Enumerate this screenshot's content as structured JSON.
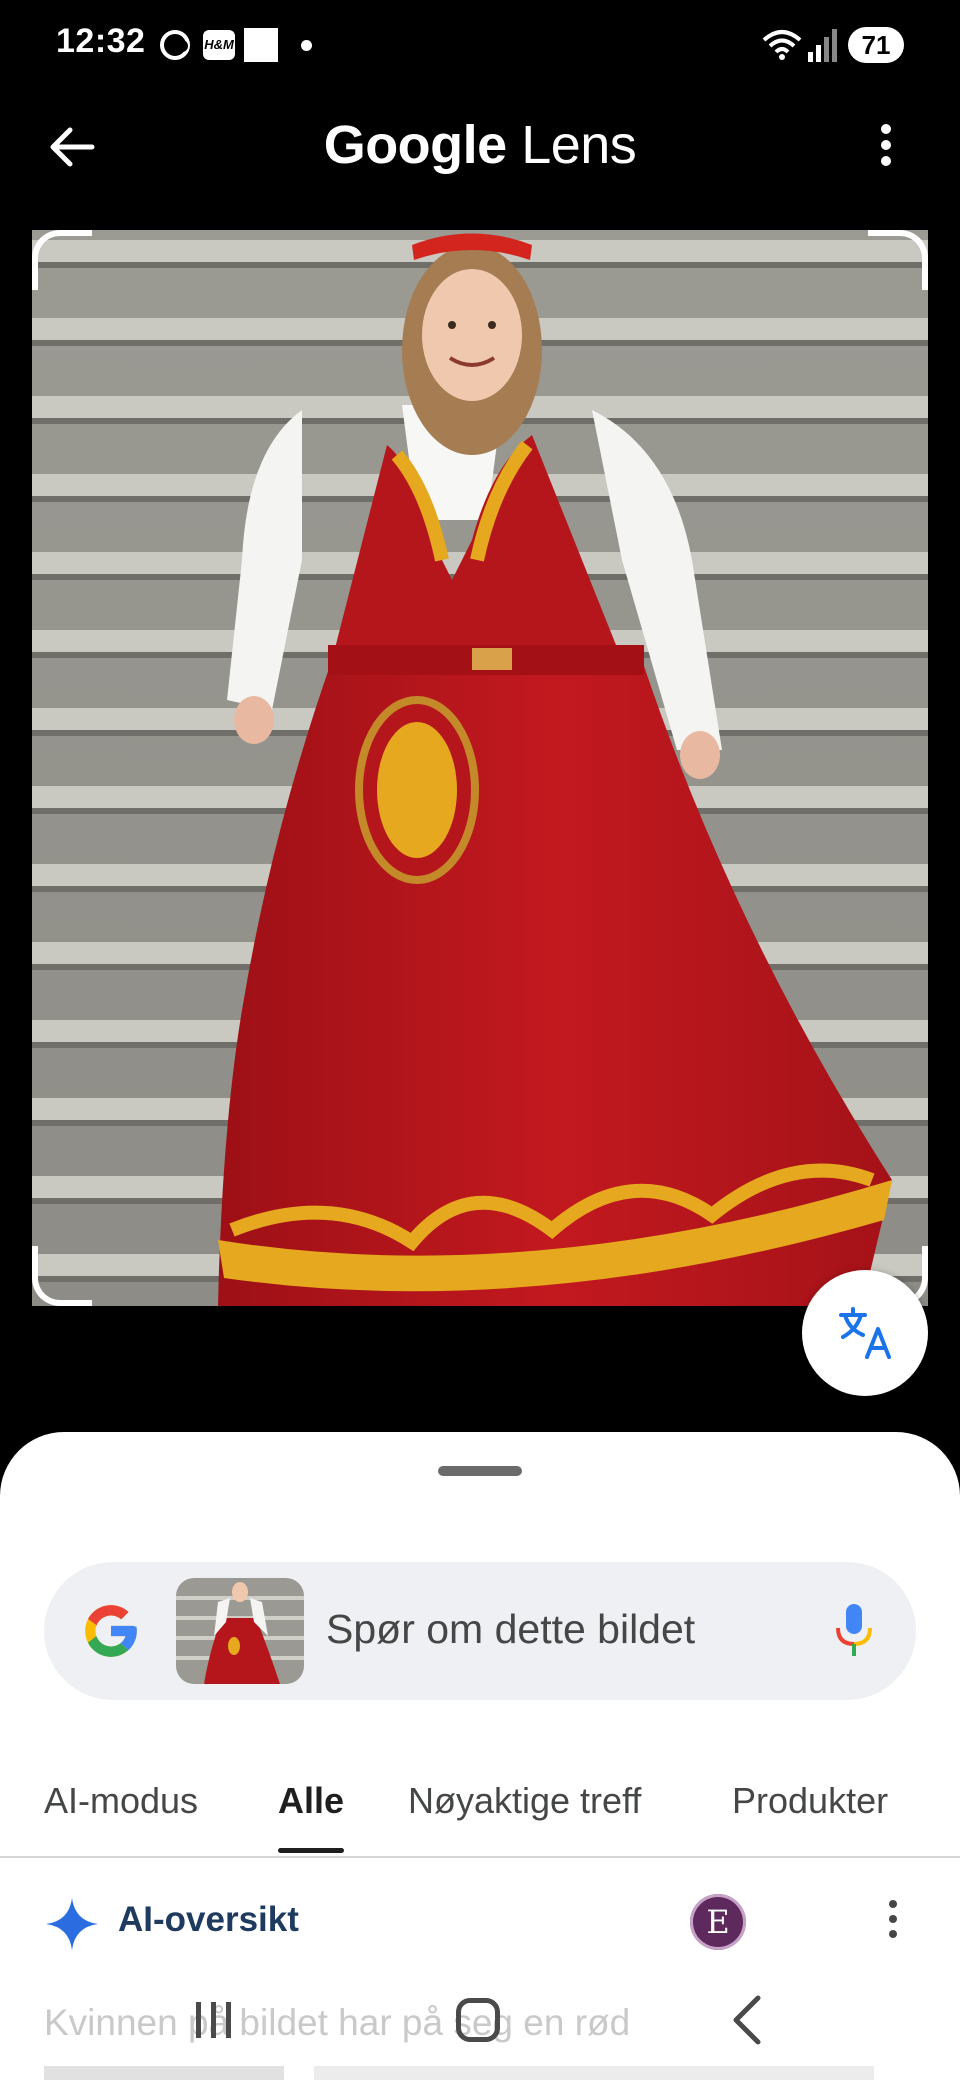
{
  "status_bar": {
    "time": "12:32",
    "hm_label": "H&M",
    "battery": "71",
    "icons": [
      "sync-icon",
      "hm-app-icon",
      "square-icon",
      "dot-icon",
      "wifi-icon",
      "signal-icon",
      "battery-icon"
    ]
  },
  "header": {
    "title_brand": "Google",
    "title_product": "Lens",
    "back_icon": "arrow-left-icon",
    "menu_icon": "more-vert-icon"
  },
  "photo": {
    "description_icon": "captured-image",
    "translate_icon": "translate-icon"
  },
  "search": {
    "placeholder": "Spør om dette bildet",
    "mic_icon": "mic-icon",
    "logo_icon": "google-g-icon"
  },
  "tabs": [
    {
      "label": "AI-modus",
      "active": false
    },
    {
      "label": "Alle",
      "active": true
    },
    {
      "label": "Nøyaktige treff",
      "active": false
    },
    {
      "label": "Produkter",
      "active": false
    }
  ],
  "ai_overview": {
    "title": "AI-oversikt",
    "avatar_letter": "E",
    "text": "Kvinnen på bildet har på seg en rød"
  },
  "colors": {
    "accent_blue": "#1a73e8",
    "dress_red": "#b5161c",
    "embroidery_gold": "#e5a81f"
  }
}
